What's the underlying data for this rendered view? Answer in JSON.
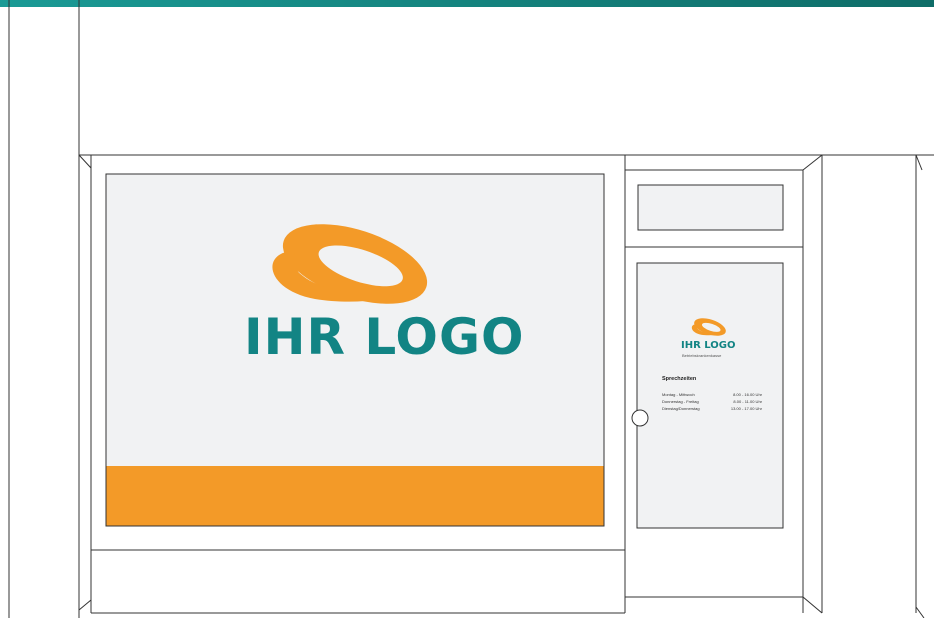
{
  "colors": {
    "top_bar_start": "#1a9a95",
    "top_bar_end": "#0f6d68",
    "logo_orange": "#f39a28",
    "logo_teal": "#128484",
    "panel_grey": "#f1f2f3",
    "line": "#333333"
  },
  "window_sign": {
    "logo_text": "IHR LOGO",
    "logo_icon": "swoosh-logo-icon"
  },
  "door_sign": {
    "logo_text": "IHR LOGO",
    "subtitle": "Betriebskrankenkasse",
    "hours_title": "Sprechzeiten",
    "hours": [
      {
        "days": "Montag - Mittwoch",
        "time": "8.00 - 16.00 Uhr"
      },
      {
        "days": "Donnerstag - Freitag",
        "time": "8.00 - 11.00 Uhr"
      },
      {
        "days": "Dienstag/Donnerstag",
        "time": "13.00 - 17.00 Uhr"
      }
    ]
  }
}
